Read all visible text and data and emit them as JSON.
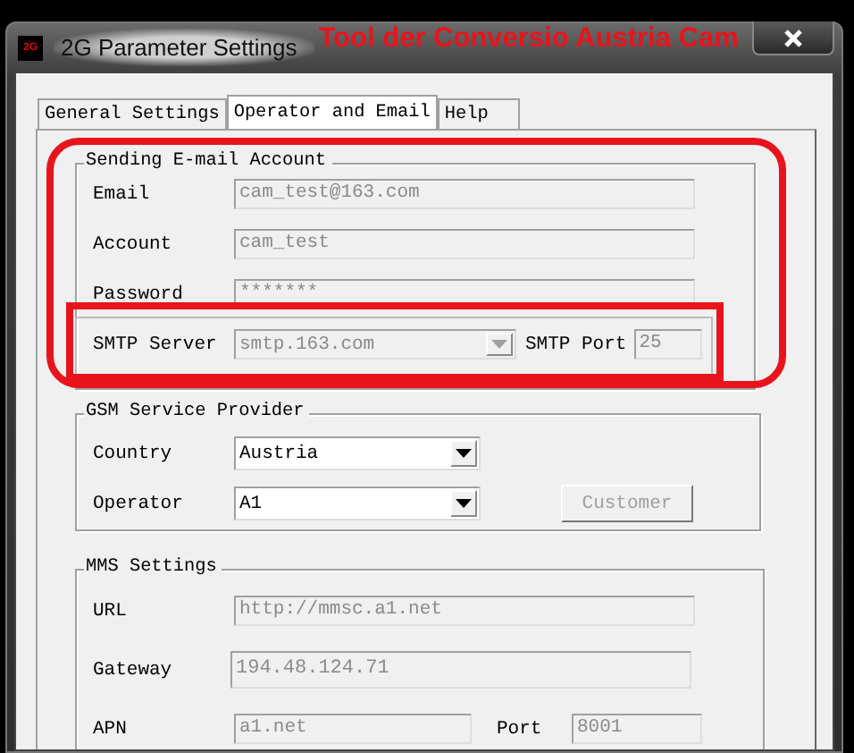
{
  "window": {
    "title": "2G Parameter Settings",
    "app_icon": "2G",
    "annotation": "Tool der Conversio Austria Cam"
  },
  "tabs": [
    {
      "label": "General Settings",
      "selected": false
    },
    {
      "label": "Operator and Email",
      "selected": true
    },
    {
      "label": "Help",
      "selected": false
    }
  ],
  "email_account": {
    "title": "Sending E-mail Account",
    "highlighted": true,
    "fields": [
      {
        "label": "Email",
        "value": "cam_test@163.com",
        "disabled": true
      },
      {
        "label": "Account",
        "value": "cam_test",
        "disabled": true
      },
      {
        "label": "Password",
        "value": "*******",
        "disabled": true
      }
    ],
    "smtp": {
      "highlighted": true,
      "server_label": "SMTP Server",
      "server_value": "smtp.163.com",
      "server_disabled": true,
      "port_label": "SMTP Port",
      "port_value": "25",
      "port_disabled": true
    }
  },
  "gsm_provider": {
    "title": "GSM Service Provider",
    "country": {
      "label": "Country",
      "value": "Austria",
      "disabled": false
    },
    "operator": {
      "label": "Operator",
      "value": "A1",
      "disabled": false
    },
    "customer_button": {
      "label": "Customer",
      "disabled": true
    }
  },
  "mms_settings": {
    "title": "MMS Settings",
    "url": {
      "label": "URL",
      "value": "http://mmsc.a1.net",
      "disabled": true
    },
    "gateway": {
      "label": "Gateway",
      "value": "194.48.124.71",
      "disabled": true
    },
    "apn": {
      "label": "APN",
      "value": "a1.net",
      "disabled": true
    },
    "port": {
      "label": "Port",
      "value": "8001",
      "disabled": true
    }
  }
}
